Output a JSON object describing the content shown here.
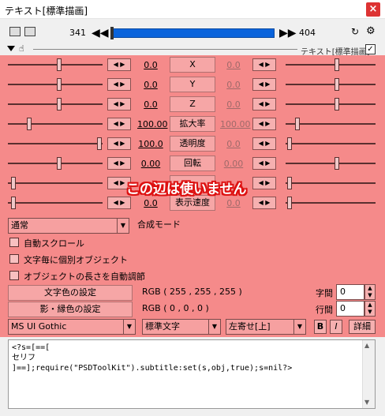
{
  "window": {
    "title": "テキスト[標準描画]",
    "close_icon": "close-icon"
  },
  "toolbar": {
    "frame_start": "341",
    "frame_end": "404",
    "prev_icon": "◀◀",
    "next_icon": "▶▶",
    "seek_progress": 0.0,
    "icons": [
      "camera-icon",
      "layer-icon",
      "loop-icon",
      "settings-icon"
    ]
  },
  "header": {
    "object_name": "テキスト[標準描画]",
    "enabled_mark": "✓"
  },
  "overlay": {
    "caption": "この辺は使いません",
    "color": "#f58a8a"
  },
  "params": [
    {
      "label": "X",
      "left": "0.0",
      "right": "0.0",
      "left_dim": false
    },
    {
      "label": "Y",
      "left": "0.0",
      "right": "0.0",
      "left_dim": false
    },
    {
      "label": "Z",
      "left": "0.0",
      "right": "0.0",
      "left_dim": false
    },
    {
      "label": "拡大率",
      "left": "100.00",
      "right": "100.00",
      "left_dim": false
    },
    {
      "label": "透明度",
      "left": "100.0",
      "right": "0.0",
      "left_dim": false
    },
    {
      "label": "回転",
      "left": "0.00",
      "right": "0.00",
      "left_dim": false
    },
    {
      "label": "",
      "left": "",
      "right": "",
      "left_dim": false
    },
    {
      "label": "表示速度",
      "left": "0.0",
      "right": "0.0",
      "left_dim": false
    }
  ],
  "arrows": {
    "left": "◀",
    "right": "▶"
  },
  "blend": {
    "value": "通常",
    "label": "合成モード"
  },
  "checkboxes": [
    {
      "label": "自動スクロール"
    },
    {
      "label": "文字毎に個別オブジェクト"
    },
    {
      "label": "オブジェクトの長さを自動調節"
    }
  ],
  "colors": {
    "text_color_button": "文字色の設定",
    "text_rgb": "RGB ( 255 , 255 , 255 )",
    "shadow_color_button": "影・縁色の設定",
    "shadow_rgb": "RGB ( 0 , 0 , 0 )"
  },
  "spacing": {
    "char_label": "字間",
    "char_value": "0",
    "line_label": "行間",
    "line_value": "0"
  },
  "font_row": {
    "font": "MS UI Gothic",
    "style": "標準文字",
    "align": "左寄せ[上]",
    "bold": "B",
    "italic": "I",
    "detail": "詳細"
  },
  "text": {
    "lines": [
      "<?s=[==[",
      "セリフ",
      "]==];require(\"PSDToolKit\").subtitle:set(s,obj,true);s=nil?>"
    ]
  }
}
